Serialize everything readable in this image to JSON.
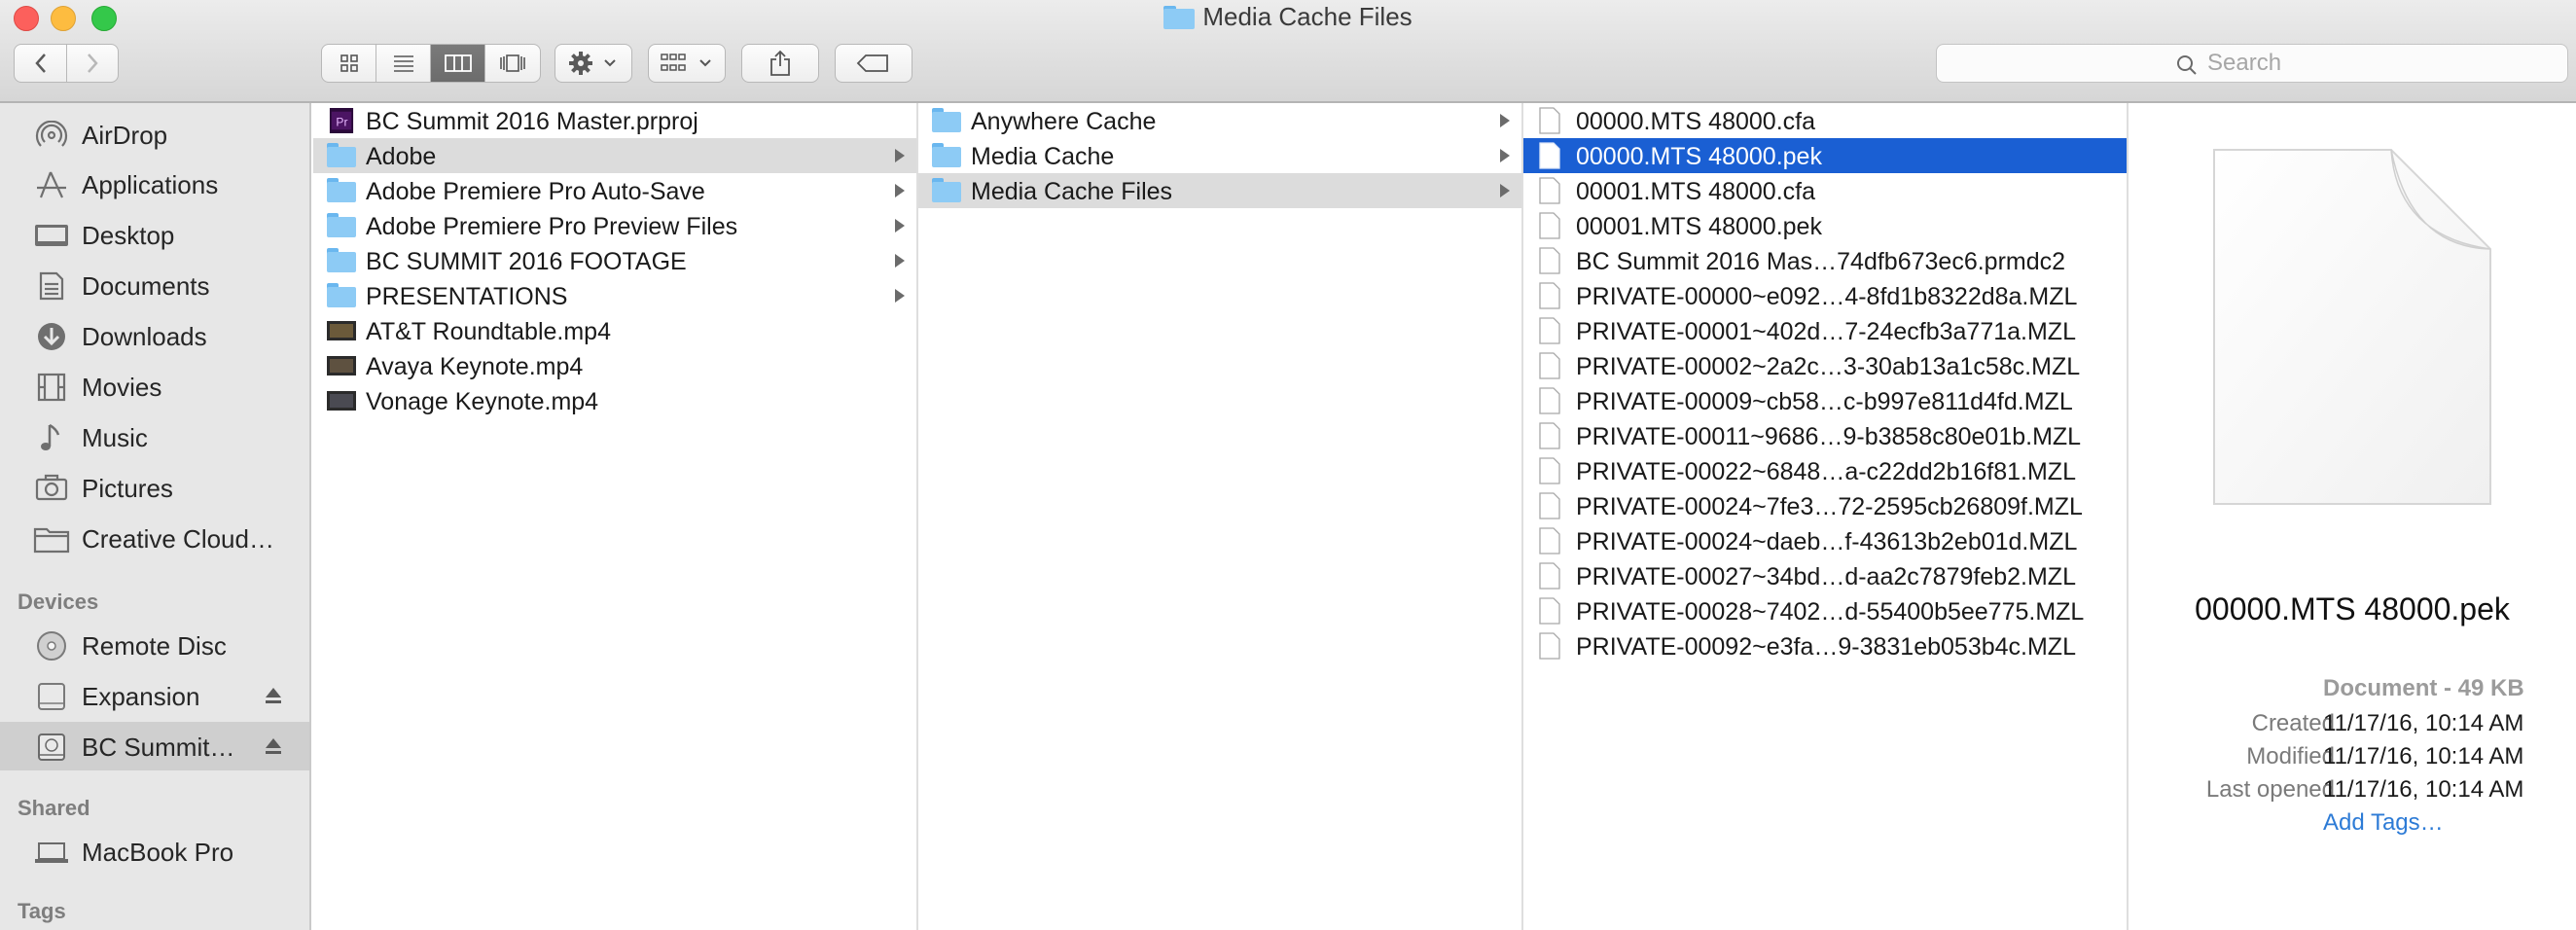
{
  "window": {
    "title": "Media Cache Files",
    "traffic_lights": [
      "#fc605c",
      "#fdbc40",
      "#34c84a"
    ]
  },
  "toolbar": {
    "view_modes": [
      "icon-view",
      "list-view",
      "column-view",
      "cover-flow-view"
    ],
    "active_view": "column-view",
    "search_placeholder": "Search"
  },
  "sidebar": {
    "favorites": [
      {
        "label": "AirDrop",
        "icon": "airdrop-icon"
      },
      {
        "label": "Applications",
        "icon": "applications-icon"
      },
      {
        "label": "Desktop",
        "icon": "desktop-icon"
      },
      {
        "label": "Documents",
        "icon": "documents-icon"
      },
      {
        "label": "Downloads",
        "icon": "downloads-icon"
      },
      {
        "label": "Movies",
        "icon": "movies-icon"
      },
      {
        "label": "Music",
        "icon": "music-icon"
      },
      {
        "label": "Pictures",
        "icon": "pictures-icon"
      },
      {
        "label": "Creative Cloud…",
        "icon": "folder-icon"
      }
    ],
    "devices_heading": "Devices",
    "devices": [
      {
        "label": "Remote Disc",
        "icon": "disc-icon"
      },
      {
        "label": "Expansion",
        "icon": "drive-icon"
      },
      {
        "label": "BC Summit…",
        "icon": "drive-icon"
      }
    ],
    "shared_heading": "Shared",
    "shared": [
      {
        "label": "MacBook Pro",
        "icon": "laptop-icon"
      }
    ],
    "tags_heading": "Tags"
  },
  "column1": [
    {
      "label": "BC Summit 2016 Master.prproj",
      "type": "premiere"
    },
    {
      "label": "Adobe",
      "type": "folder"
    },
    {
      "label": "Adobe Premiere Pro Auto-Save",
      "type": "folder"
    },
    {
      "label": "Adobe Premiere Pro Preview Files",
      "type": "folder"
    },
    {
      "label": "BC SUMMIT 2016 FOOTAGE",
      "type": "folder"
    },
    {
      "label": "PRESENTATIONS",
      "type": "folder"
    },
    {
      "label": "AT&T Roundtable.mp4",
      "type": "video"
    },
    {
      "label": "Avaya Keynote.mp4",
      "type": "video"
    },
    {
      "label": "Vonage Keynote.mp4",
      "type": "video"
    }
  ],
  "column2": [
    {
      "label": "Anywhere Cache",
      "type": "folder"
    },
    {
      "label": "Media Cache",
      "type": "folder"
    },
    {
      "label": "Media Cache Files",
      "type": "folder"
    }
  ],
  "column3": [
    "00000.MTS 48000.cfa",
    "00000.MTS 48000.pek",
    "00001.MTS 48000.cfa",
    "00001.MTS 48000.pek",
    "BC Summit 2016 Mas…74dfb673ec6.prmdc2",
    "PRIVATE-00000~e092…4-8fd1b8322d8a.MZL",
    "PRIVATE-00001~402d…7-24ecfb3a771a.MZL",
    "PRIVATE-00002~2a2c…3-30ab13a1c58c.MZL",
    "PRIVATE-00009~cb58…c-b997e811d4fd.MZL",
    "PRIVATE-00011~9686…9-b3858c80e01b.MZL",
    "PRIVATE-00022~6848…a-c22dd2b16f81.MZL",
    "PRIVATE-00024~7fe3…72-2595cb26809f.MZL",
    "PRIVATE-00024~daeb…f-43613b2eb01d.MZL",
    "PRIVATE-00027~34bd…d-aa2c7879feb2.MZL",
    "PRIVATE-00028~7402…d-55400b5ee775.MZL",
    "PRIVATE-00092~e3fa…9-3831eb053b4c.MZL"
  ],
  "preview": {
    "filename": "00000.MTS 48000.pek",
    "kind": "Document - 49 KB",
    "created_label": "Created",
    "created": "11/17/16, 10:14 AM",
    "modified_label": "Modified",
    "modified": "11/17/16, 10:14 AM",
    "last_opened_label": "Last opened",
    "last_opened": "11/17/16, 10:14 AM",
    "add_tags": "Add Tags…"
  },
  "colors": {
    "selection_blue": "#1a5fd3",
    "selection_gray": "#dcdcdc",
    "sidebar_bg": "#e7e7e7",
    "link_blue": "#2d7bd6"
  }
}
